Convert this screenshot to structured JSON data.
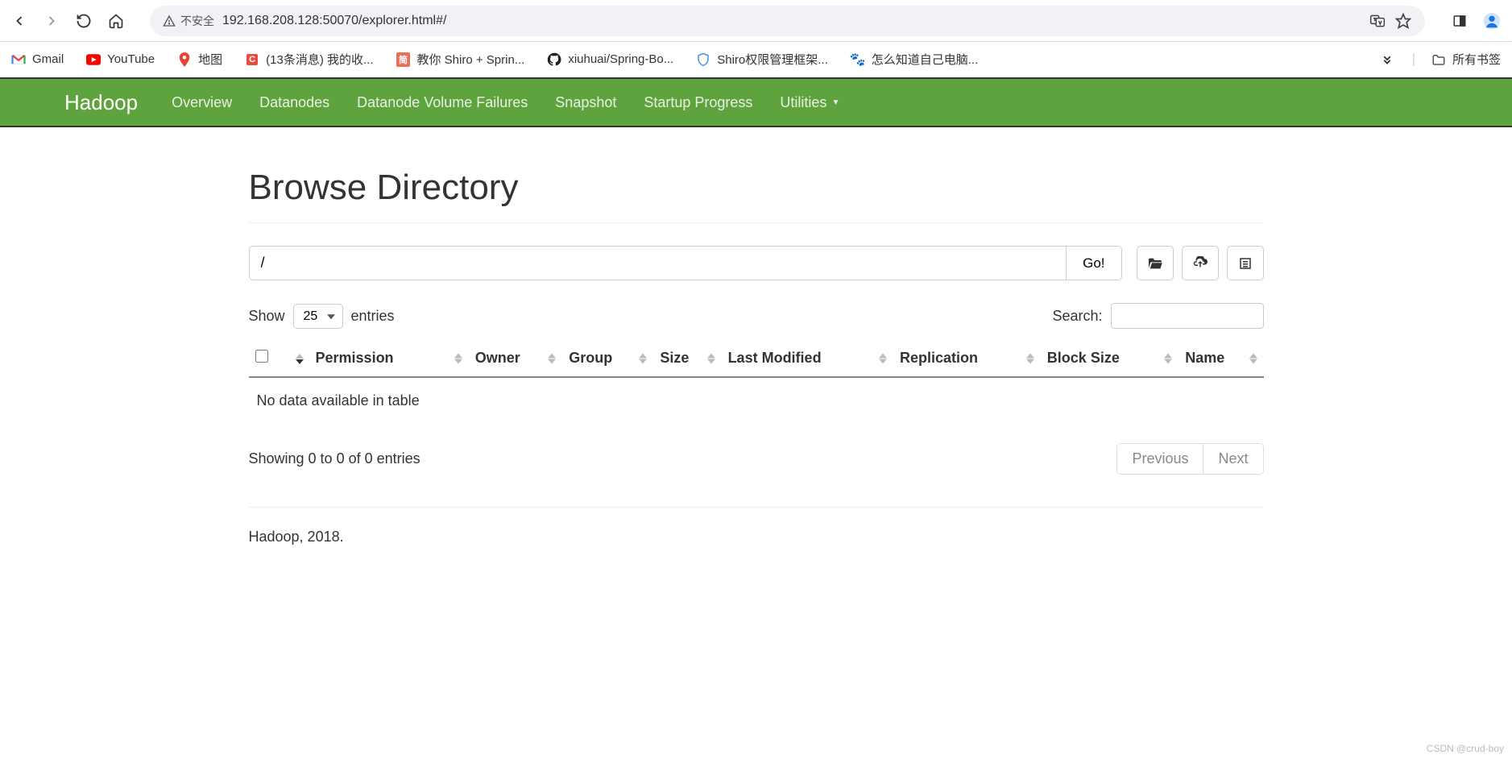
{
  "browser": {
    "insecure_label": "不安全",
    "url": "192.168.208.128:50070/explorer.html#/"
  },
  "bookmarks": [
    {
      "label": "Gmail"
    },
    {
      "label": "YouTube"
    },
    {
      "label": "地图"
    },
    {
      "label": "(13条消息) 我的收..."
    },
    {
      "label": "教你 Shiro + Sprin..."
    },
    {
      "label": "xiuhuai/Spring-Bo..."
    },
    {
      "label": "Shiro权限管理框架..."
    },
    {
      "label": "怎么知道自己电脑..."
    }
  ],
  "bookmarks_right": {
    "all_label": "所有书签"
  },
  "nav": {
    "brand": "Hadoop",
    "items": [
      "Overview",
      "Datanodes",
      "Datanode Volume Failures",
      "Snapshot",
      "Startup Progress",
      "Utilities"
    ]
  },
  "page": {
    "title": "Browse Directory",
    "path_value": "/",
    "go_label": "Go!",
    "show_label": "Show",
    "entries_label": "entries",
    "entries_value": "25",
    "search_label": "Search:",
    "columns": [
      "Permission",
      "Owner",
      "Group",
      "Size",
      "Last Modified",
      "Replication",
      "Block Size",
      "Name"
    ],
    "empty_msg": "No data available in table",
    "showing_text": "Showing 0 to 0 of 0 entries",
    "previous_label": "Previous",
    "next_label": "Next",
    "footer": "Hadoop, 2018."
  },
  "watermark": "CSDN @crud-boy"
}
